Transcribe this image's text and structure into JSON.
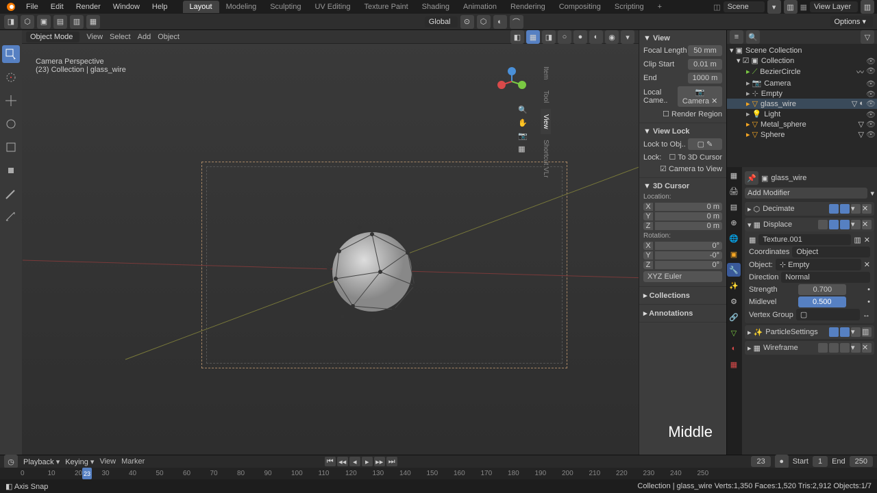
{
  "menubar": {
    "items": [
      "File",
      "Edit",
      "Render",
      "Window",
      "Help"
    ],
    "workspaceTabs": [
      "Layout",
      "Modeling",
      "Sculpting",
      "UV Editing",
      "Texture Paint",
      "Shading",
      "Animation",
      "Rendering",
      "Compositing",
      "Scripting"
    ],
    "activeTab": "Layout",
    "scene_label": "Scene",
    "viewlayer_label": "View Layer"
  },
  "toolbar2": {
    "orientation": "Global"
  },
  "viewport": {
    "mode": "Object Mode",
    "menus": [
      "View",
      "Select",
      "Add",
      "Object"
    ],
    "persp_label": "Camera Perspective",
    "scene_path": "(23) Collection | glass_wire"
  },
  "npanel": {
    "view": {
      "title": "View",
      "focal_length_label": "Focal Length",
      "focal_length": "50 mm",
      "clip_start_label": "Clip Start",
      "clip_start": "0.01 m",
      "end_label": "End",
      "end": "1000 m",
      "local_cam_label": "Local Came..",
      "local_cam": "Camera",
      "render_region": "Render Region"
    },
    "view_lock": {
      "title": "View Lock",
      "lock_to_obj": "Lock to Obj..",
      "lock": "Lock:",
      "to3d": "To 3D Cursor",
      "cam_to_view": "Camera to View"
    },
    "cursor": {
      "title": "3D Cursor",
      "location": "Location:",
      "loc": {
        "x": "0 m",
        "y": "0 m",
        "z": "0 m"
      },
      "rotation": "Rotation:",
      "rot": {
        "x": "0°",
        "y": "-0°",
        "z": "0°"
      },
      "mode": "XYZ Euler"
    },
    "collections_title": "Collections",
    "annotations_title": "Annotations",
    "tabs": [
      "Item",
      "Tool",
      "View",
      "Shortcut VLr"
    ]
  },
  "outliner": {
    "root": "Scene Collection",
    "collection": "Collection",
    "items": [
      "BezierCircle",
      "Camera",
      "Empty",
      "glass_wire",
      "Light",
      "Metal_sphere",
      "Sphere"
    ],
    "selected": "glass_wire"
  },
  "properties": {
    "breadcrumb": "glass_wire",
    "add_modifier": "Add Modifier",
    "modifiers": {
      "decimate": {
        "name": "Decimate"
      },
      "displace": {
        "name": "Displace",
        "texture": "Texture.001",
        "coords_label": "Coordinates",
        "coords": "Object",
        "object_label": "Object:",
        "object": "Empty",
        "direction_label": "Direction",
        "direction": "Normal",
        "strength_label": "Strength",
        "strength": "0.700",
        "midlevel_label": "Midlevel",
        "midlevel": "0.500",
        "vgroup_label": "Vertex Group"
      },
      "particles": {
        "name": "ParticleSettings"
      },
      "wireframe": {
        "name": "Wireframe"
      }
    }
  },
  "timeline": {
    "menus": [
      "Playback",
      "Keying",
      "View",
      "Marker"
    ],
    "current": "23",
    "start_label": "Start",
    "start": "1",
    "end_label": "End",
    "end": "250",
    "ticks": [
      "0",
      "10",
      "20",
      "30",
      "40",
      "50",
      "60",
      "70",
      "80",
      "90",
      "100",
      "110",
      "120",
      "130",
      "140",
      "150",
      "160",
      "170",
      "180",
      "190",
      "200",
      "210",
      "220",
      "230",
      "240",
      "250"
    ]
  },
  "status": {
    "mode": "Axis Snap",
    "info": "Collection | glass_wire   Verts:1,350   Faces:1,520   Tris:2,912   Objects:1/7"
  },
  "overlay": "Middle",
  "icons": {
    "blender": "blender-icon"
  }
}
